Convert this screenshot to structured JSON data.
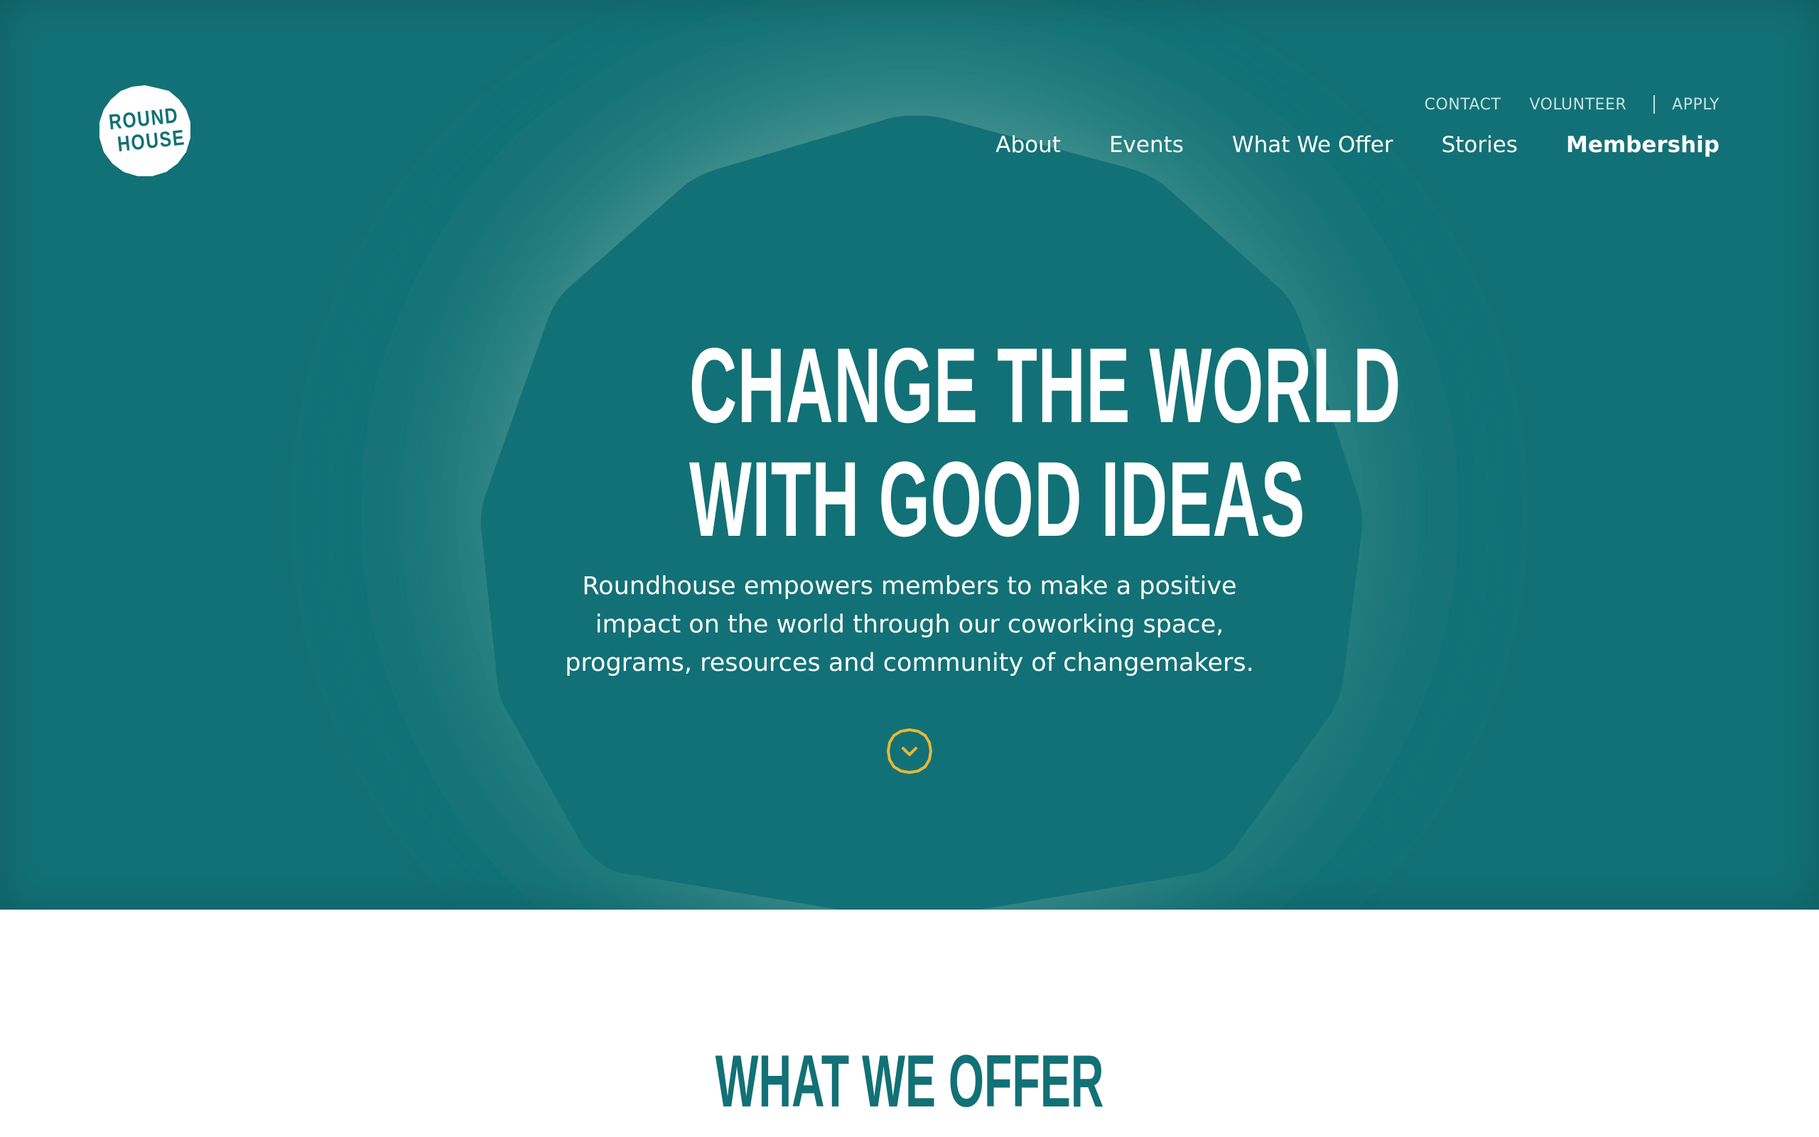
{
  "brand": {
    "logo_line1": "ROUND",
    "logo_line2": "HOUSE",
    "logo_name": "roundhouse-logo"
  },
  "utility_nav": {
    "items": [
      "CONTACT",
      "VOLUNTEER",
      "APPLY"
    ]
  },
  "main_nav": {
    "items": [
      "About",
      "Events",
      "What We Offer",
      "Stories",
      "Membership"
    ],
    "highlighted": "Membership"
  },
  "hero": {
    "headline_line1": "CHANGE THE WORLD",
    "headline_line2": "WITH GOOD IDEAS",
    "sub_line1": "Roundhouse empowers members to make a positive",
    "sub_line2": "impact on the world through our coworking space,",
    "sub_line3": "programs, resources and community of changemakers.",
    "scroll_icon": "chevron-down-circle-icon"
  },
  "offer_section": {
    "title": "WHAT WE OFFER"
  },
  "colors": {
    "teal": "#127176",
    "teal_glow": "#5aa39c",
    "accent_yellow": "#e8b73a",
    "white": "#ffffff"
  }
}
